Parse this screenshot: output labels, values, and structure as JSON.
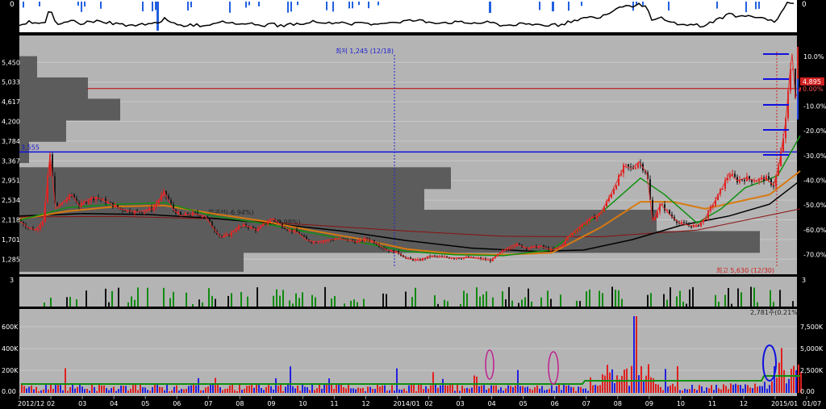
{
  "chart_data": {
    "type": "candlestick",
    "price_axis": {
      "ticks": [
        "5,450",
        "5,033",
        "4,617",
        "4,200",
        "3,784",
        "3,367",
        "2,951",
        "2,534",
        "2,118",
        "1,701",
        "1,285"
      ],
      "tick_values": [
        5450,
        5033,
        4617,
        4200,
        3784,
        3367,
        2951,
        2534,
        2118,
        1701,
        1285
      ],
      "range": [
        1000,
        5950
      ]
    },
    "pct_axis": {
      "ticks": [
        "10.0%",
        "0.00%",
        "-10.0%",
        "-20.0%",
        "-30.0%",
        "-40.0%",
        "-50.0%",
        "-60.0%",
        "-70.0%"
      ]
    },
    "current_price": {
      "label": "4,895",
      "pct": "0.00%",
      "value": 4895
    },
    "marker_3555": {
      "label": "3,555",
      "value": 3555
    },
    "annotations": {
      "low": "최저 1,245 (12/18)",
      "high": "최고 5,630 (12/30)",
      "ma_a": "회귀선(-6.94%)",
      "ma_b": "(-0.98%)"
    },
    "volume_axis": {
      "ticks": [
        "600K",
        "400K",
        "200K",
        "0.00"
      ],
      "right_ticks": [
        "7,500K",
        "5,000K",
        "2,500K",
        "0.00"
      ],
      "note": "2,781주(0.21%)"
    },
    "indicator_axis": {
      "top": "0",
      "mid": "3"
    },
    "x_labels": [
      "2012/12",
      "02",
      "03",
      "04",
      "05",
      "06",
      "07",
      "08",
      "09",
      "10",
      "11",
      "12",
      "2014/01",
      "02",
      "03",
      "04",
      "05",
      "06",
      "07",
      "08",
      "09",
      "10",
      "11",
      "12",
      "2015/01",
      "01/07"
    ],
    "volume_profile": [
      {
        "price": 5350,
        "width": 22
      },
      {
        "price": 4900,
        "width": 85
      },
      {
        "price": 4450,
        "width": 125
      },
      {
        "price": 4000,
        "width": 58
      },
      {
        "price": 3550,
        "width": 12
      },
      {
        "price": 3000,
        "width": 535
      },
      {
        "price": 2550,
        "width": 502
      },
      {
        "price": 2100,
        "width": 790
      },
      {
        "price": 1650,
        "width": 918
      },
      {
        "price": 1250,
        "width": 278
      }
    ],
    "close_series": [
      [
        0,
        2100
      ],
      [
        10,
        1960
      ],
      [
        20,
        1900
      ],
      [
        30,
        2120
      ],
      [
        38,
        3500
      ],
      [
        45,
        2350
      ],
      [
        55,
        2500
      ],
      [
        65,
        2650
      ],
      [
        75,
        2400
      ],
      [
        85,
        2550
      ],
      [
        95,
        2600
      ],
      [
        110,
        2480
      ],
      [
        125,
        2350
      ],
      [
        145,
        2280
      ],
      [
        165,
        2350
      ],
      [
        180,
        2700
      ],
      [
        190,
        2350
      ],
      [
        200,
        2200
      ],
      [
        215,
        2250
      ],
      [
        230,
        2200
      ],
      [
        240,
        1950
      ],
      [
        250,
        1750
      ],
      [
        260,
        1800
      ],
      [
        270,
        1950
      ],
      [
        280,
        2000
      ],
      [
        295,
        1900
      ],
      [
        305,
        2050
      ],
      [
        315,
        2150
      ],
      [
        325,
        2000
      ],
      [
        335,
        1900
      ],
      [
        345,
        1850
      ],
      [
        355,
        1700
      ],
      [
        365,
        1650
      ],
      [
        380,
        1680
      ],
      [
        395,
        1720
      ],
      [
        410,
        1680
      ],
      [
        420,
        1650
      ],
      [
        430,
        1720
      ],
      [
        440,
        1650
      ],
      [
        455,
        1480
      ],
      [
        470,
        1420
      ],
      [
        480,
        1300
      ],
      [
        495,
        1260
      ],
      [
        510,
        1350
      ],
      [
        525,
        1330
      ],
      [
        540,
        1310
      ],
      [
        555,
        1320
      ],
      [
        570,
        1300
      ],
      [
        585,
        1260
      ],
      [
        595,
        1400
      ],
      [
        605,
        1520
      ],
      [
        615,
        1600
      ],
      [
        630,
        1520
      ],
      [
        645,
        1560
      ],
      [
        660,
        1480
      ],
      [
        672,
        1560
      ],
      [
        680,
        1750
      ],
      [
        690,
        1900
      ],
      [
        700,
        2050
      ],
      [
        710,
        2150
      ],
      [
        720,
        2250
      ],
      [
        730,
        2550
      ],
      [
        740,
        2900
      ],
      [
        750,
        3250
      ],
      [
        760,
        3200
      ],
      [
        768,
        3350
      ],
      [
        778,
        3100
      ],
      [
        785,
        2100
      ],
      [
        795,
        2450
      ],
      [
        808,
        2200
      ],
      [
        818,
        2050
      ],
      [
        830,
        2000
      ],
      [
        840,
        1980
      ],
      [
        850,
        2150
      ],
      [
        860,
        2450
      ],
      [
        870,
        2750
      ],
      [
        880,
        3100
      ],
      [
        890,
        2950
      ],
      [
        900,
        3000
      ],
      [
        912,
        2950
      ],
      [
        925,
        3000
      ],
      [
        935,
        2850
      ],
      [
        942,
        3300
      ],
      [
        950,
        4200
      ],
      [
        955,
        5200
      ],
      [
        958,
        5630
      ],
      [
        962,
        4700
      ],
      [
        968,
        4900
      ]
    ],
    "ma_green": [
      [
        0,
        2110
      ],
      [
        60,
        2380
      ],
      [
        120,
        2450
      ],
      [
        180,
        2480
      ],
      [
        240,
        2200
      ],
      [
        300,
        2050
      ],
      [
        360,
        1850
      ],
      [
        420,
        1650
      ],
      [
        480,
        1450
      ],
      [
        540,
        1380
      ],
      [
        600,
        1360
      ],
      [
        660,
        1480
      ],
      [
        720,
        2250
      ],
      [
        770,
        3000
      ],
      [
        800,
        2650
      ],
      [
        840,
        2050
      ],
      [
        870,
        2350
      ],
      [
        900,
        2800
      ],
      [
        940,
        3050
      ],
      [
        968,
        3900
      ]
    ],
    "ma_orange": [
      [
        0,
        2130
      ],
      [
        60,
        2300
      ],
      [
        120,
        2400
      ],
      [
        180,
        2420
      ],
      [
        240,
        2250
      ],
      [
        300,
        2100
      ],
      [
        360,
        1900
      ],
      [
        420,
        1720
      ],
      [
        480,
        1500
      ],
      [
        540,
        1400
      ],
      [
        600,
        1380
      ],
      [
        660,
        1420
      ],
      [
        720,
        1950
      ],
      [
        770,
        2500
      ],
      [
        810,
        2500
      ],
      [
        850,
        2350
      ],
      [
        890,
        2500
      ],
      [
        930,
        2650
      ],
      [
        968,
        3150
      ]
    ],
    "ma_black": [
      [
        0,
        2200
      ],
      [
        80,
        2250
      ],
      [
        160,
        2230
      ],
      [
        240,
        2150
      ],
      [
        320,
        2030
      ],
      [
        400,
        1880
      ],
      [
        480,
        1680
      ],
      [
        560,
        1520
      ],
      [
        640,
        1450
      ],
      [
        700,
        1480
      ],
      [
        760,
        1700
      ],
      [
        820,
        2000
      ],
      [
        880,
        2200
      ],
      [
        930,
        2450
      ],
      [
        968,
        2950
      ]
    ],
    "ma_darkred": [
      [
        0,
        2180
      ],
      [
        120,
        2190
      ],
      [
        240,
        2140
      ],
      [
        360,
        2010
      ],
      [
        480,
        1880
      ],
      [
        600,
        1770
      ],
      [
        720,
        1760
      ],
      [
        840,
        1900
      ],
      [
        968,
        2350
      ]
    ],
    "hlines": {
      "blue": 3555,
      "red": 4895
    }
  }
}
